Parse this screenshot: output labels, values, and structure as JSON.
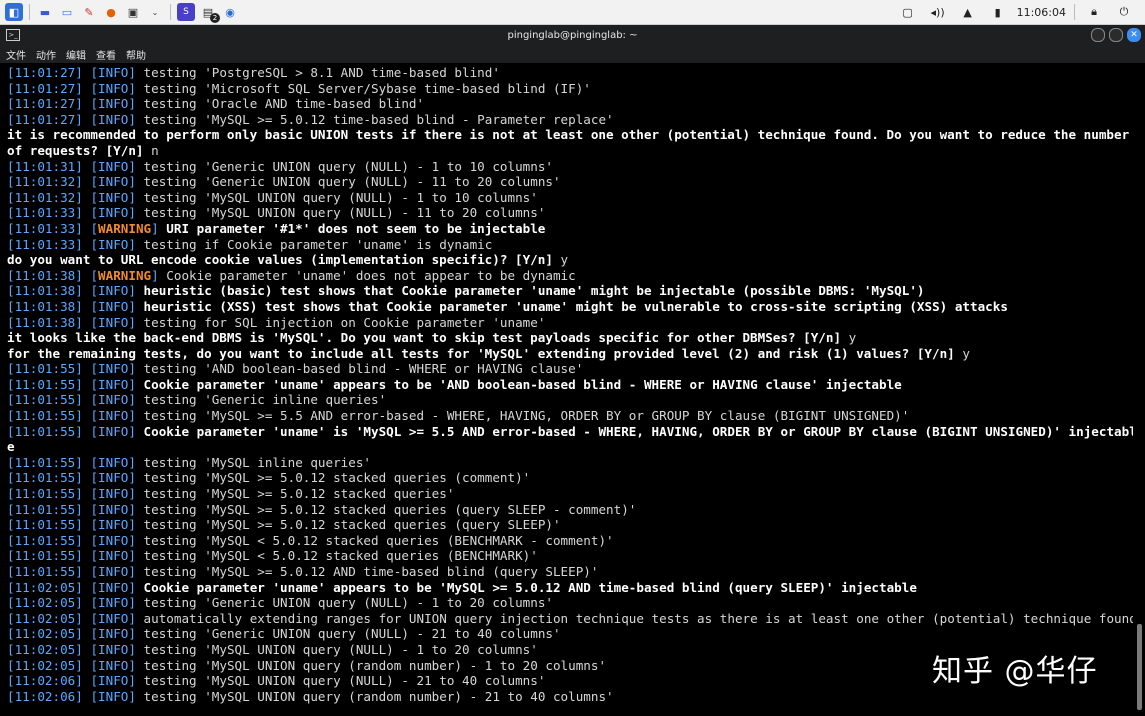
{
  "taskbar": {
    "time": "11:06:04",
    "notif_count": "2"
  },
  "window": {
    "title": "pinginglab@pinginglab: ~"
  },
  "menu": [
    "文件",
    "动作",
    "编辑",
    "查看",
    "帮助"
  ],
  "lines": [
    {
      "ts": "11:01:27",
      "lvl": "INFO",
      "text": "testing 'PostgreSQL > 8.1 AND time-based blind'"
    },
    {
      "ts": "11:01:27",
      "lvl": "INFO",
      "text": "testing 'Microsoft SQL Server/Sybase time-based blind (IF)'"
    },
    {
      "ts": "11:01:27",
      "lvl": "INFO",
      "text": "testing 'Oracle AND time-based blind'"
    },
    {
      "ts": "11:01:27",
      "lvl": "INFO",
      "text": "testing 'MySQL >= 5.0.12 time-based blind - Parameter replace'"
    },
    {
      "bold": true,
      "text": "it is recommended to perform only basic UNION tests if there is not at least one other (potential) technique found. Do you want to reduce the number"
    },
    {
      "bold": true,
      "text": "of requests? [Y/n] ",
      "ans": "n"
    },
    {
      "ts": "11:01:31",
      "lvl": "INFO",
      "text": "testing 'Generic UNION query (NULL) - 1 to 10 columns'"
    },
    {
      "ts": "11:01:32",
      "lvl": "INFO",
      "text": "testing 'Generic UNION query (NULL) - 11 to 20 columns'"
    },
    {
      "ts": "11:01:32",
      "lvl": "INFO",
      "text": "testing 'MySQL UNION query (NULL) - 1 to 10 columns'"
    },
    {
      "ts": "11:01:33",
      "lvl": "INFO",
      "text": "testing 'MySQL UNION query (NULL) - 11 to 20 columns'"
    },
    {
      "ts": "11:01:33",
      "lvl": "WARNING",
      "text": "URI parameter '#1*' does not seem to be injectable",
      "bold": true
    },
    {
      "ts": "11:01:33",
      "lvl": "INFO",
      "text": "testing if Cookie parameter 'uname' is dynamic"
    },
    {
      "bold": true,
      "text": "do you want to URL encode cookie values (implementation specific)? [Y/n] ",
      "ans": "y"
    },
    {
      "ts": "11:01:38",
      "lvl": "WARNING",
      "text": "Cookie parameter 'uname' does not appear to be dynamic"
    },
    {
      "ts": "11:01:38",
      "lvl": "INFO",
      "text": "heuristic (basic) test shows that Cookie parameter 'uname' might be injectable (possible DBMS: 'MySQL')",
      "bold": true
    },
    {
      "ts": "11:01:38",
      "lvl": "INFO",
      "text": "heuristic (XSS) test shows that Cookie parameter 'uname' might be vulnerable to cross-site scripting (XSS) attacks",
      "bold": true
    },
    {
      "ts": "11:01:38",
      "lvl": "INFO",
      "text": "testing for SQL injection on Cookie parameter 'uname'"
    },
    {
      "bold": true,
      "text": "it looks like the back-end DBMS is 'MySQL'. Do you want to skip test payloads specific for other DBMSes? [Y/n] ",
      "ans": "y"
    },
    {
      "bold": true,
      "text": "for the remaining tests, do you want to include all tests for 'MySQL' extending provided level (2) and risk (1) values? [Y/n] ",
      "ans": "y"
    },
    {
      "ts": "11:01:55",
      "lvl": "INFO",
      "text": "testing 'AND boolean-based blind - WHERE or HAVING clause'"
    },
    {
      "ts": "11:01:55",
      "lvl": "INFO",
      "text": "Cookie parameter 'uname' appears to be 'AND boolean-based blind - WHERE or HAVING clause' injectable",
      "bold": true
    },
    {
      "ts": "11:01:55",
      "lvl": "INFO",
      "text": "testing 'Generic inline queries'"
    },
    {
      "ts": "11:01:55",
      "lvl": "INFO",
      "text": "testing 'MySQL >= 5.5 AND error-based - WHERE, HAVING, ORDER BY or GROUP BY clause (BIGINT UNSIGNED)'"
    },
    {
      "ts": "11:01:55",
      "lvl": "INFO",
      "text": "Cookie parameter 'uname' is 'MySQL >= 5.5 AND error-based - WHERE, HAVING, ORDER BY or GROUP BY clause (BIGINT UNSIGNED)' injectabl",
      "bold": true
    },
    {
      "bold": true,
      "text": "e"
    },
    {
      "ts": "11:01:55",
      "lvl": "INFO",
      "text": "testing 'MySQL inline queries'"
    },
    {
      "ts": "11:01:55",
      "lvl": "INFO",
      "text": "testing 'MySQL >= 5.0.12 stacked queries (comment)'"
    },
    {
      "ts": "11:01:55",
      "lvl": "INFO",
      "text": "testing 'MySQL >= 5.0.12 stacked queries'"
    },
    {
      "ts": "11:01:55",
      "lvl": "INFO",
      "text": "testing 'MySQL >= 5.0.12 stacked queries (query SLEEP - comment)'"
    },
    {
      "ts": "11:01:55",
      "lvl": "INFO",
      "text": "testing 'MySQL >= 5.0.12 stacked queries (query SLEEP)'"
    },
    {
      "ts": "11:01:55",
      "lvl": "INFO",
      "text": "testing 'MySQL < 5.0.12 stacked queries (BENCHMARK - comment)'"
    },
    {
      "ts": "11:01:55",
      "lvl": "INFO",
      "text": "testing 'MySQL < 5.0.12 stacked queries (BENCHMARK)'"
    },
    {
      "ts": "11:01:55",
      "lvl": "INFO",
      "text": "testing 'MySQL >= 5.0.12 AND time-based blind (query SLEEP)'"
    },
    {
      "ts": "11:02:05",
      "lvl": "INFO",
      "text": "Cookie parameter 'uname' appears to be 'MySQL >= 5.0.12 AND time-based blind (query SLEEP)' injectable",
      "bold": true
    },
    {
      "ts": "11:02:05",
      "lvl": "INFO",
      "text": "testing 'Generic UNION query (NULL) - 1 to 20 columns'"
    },
    {
      "ts": "11:02:05",
      "lvl": "INFO",
      "text": "automatically extending ranges for UNION query injection technique tests as there is at least one other (potential) technique found"
    },
    {
      "ts": "11:02:05",
      "lvl": "INFO",
      "text": "testing 'Generic UNION query (NULL) - 21 to 40 columns'"
    },
    {
      "ts": "11:02:05",
      "lvl": "INFO",
      "text": "testing 'MySQL UNION query (NULL) - 1 to 20 columns'"
    },
    {
      "ts": "11:02:05",
      "lvl": "INFO",
      "text": "testing 'MySQL UNION query (random number) - 1 to 20 columns'"
    },
    {
      "ts": "11:02:06",
      "lvl": "INFO",
      "text": "testing 'MySQL UNION query (NULL) - 21 to 40 columns'"
    },
    {
      "ts": "11:02:06",
      "lvl": "INFO",
      "text": "testing 'MySQL UNION query (random number) - 21 to 40 columns'"
    }
  ],
  "watermark": "知乎 @华仔"
}
